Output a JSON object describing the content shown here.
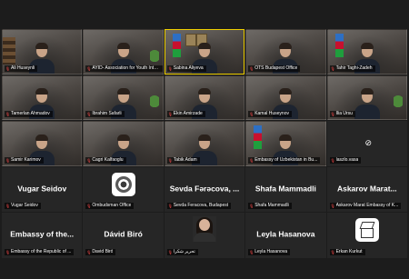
{
  "participants": [
    {
      "name": "Ali Huseynli",
      "kind": "video",
      "muted": true
    },
    {
      "name": "AYID- Association for Youth Inte...",
      "kind": "video",
      "muted": true
    },
    {
      "name": "Sabina Aliyeva",
      "kind": "video",
      "muted": true,
      "active": true
    },
    {
      "name": "OTS Budapest Office",
      "kind": "video",
      "muted": true
    },
    {
      "name": "Tahir Taghi-Zadeh",
      "kind": "video",
      "muted": true
    },
    {
      "name": "Tamerlan Ahmadov",
      "kind": "video",
      "muted": true
    },
    {
      "name": "Ibrahim Safarli",
      "kind": "video",
      "muted": true
    },
    {
      "name": "Ekin Amirzade",
      "kind": "video",
      "muted": true
    },
    {
      "name": "Kamal Huseynov",
      "kind": "video",
      "muted": true
    },
    {
      "name": "Ilia Ursu",
      "kind": "video",
      "muted": true
    },
    {
      "name": "Samir Karimov",
      "kind": "video",
      "muted": true
    },
    {
      "name": "Cagri Kalfaoglu",
      "kind": "video",
      "muted": true
    },
    {
      "name": "Tabik Adam",
      "kind": "video",
      "muted": true
    },
    {
      "name": "Embassy of Uzbekistan in Bu...",
      "kind": "video",
      "muted": true
    },
    {
      "name": "laszlo.vasa",
      "kind": "camera-off",
      "muted": true
    },
    {
      "name": "Vugar Seidov",
      "kind": "name",
      "display": "Vugar Seidov",
      "muted": true
    },
    {
      "name": "Ombudsman Office",
      "kind": "logo",
      "logo": "emblem-icon",
      "muted": true
    },
    {
      "name": "Sevda Feracova, Budapest",
      "kind": "name",
      "display": "Sevda Fərəcova, ...",
      "muted": true
    },
    {
      "name": "Shafa Mammadli",
      "kind": "name",
      "display": "Shafa Mammadli",
      "muted": true
    },
    {
      "name": "Askarov Marat Embassy of K...",
      "kind": "name",
      "display": "Askarov Marat...",
      "muted": true
    },
    {
      "name": "Embassy of the Republic of ...",
      "kind": "name",
      "display": "Embassy of the...",
      "muted": true
    },
    {
      "name": "David Biró",
      "kind": "name",
      "display": "Dávid Biró",
      "muted": true
    },
    {
      "name": "تحریر شکرا",
      "kind": "portrait",
      "muted": true
    },
    {
      "name": "Leyla Hasanova",
      "kind": "name",
      "display": "Leyla Hasanova",
      "muted": true
    },
    {
      "name": "Erkan Kurkut",
      "kind": "logo",
      "logo": "cube-icon",
      "muted": true
    }
  ],
  "colors": {
    "active_border": "#f0d000",
    "muted_mic": "#ff4a4a",
    "background": "#1c1c1c"
  }
}
